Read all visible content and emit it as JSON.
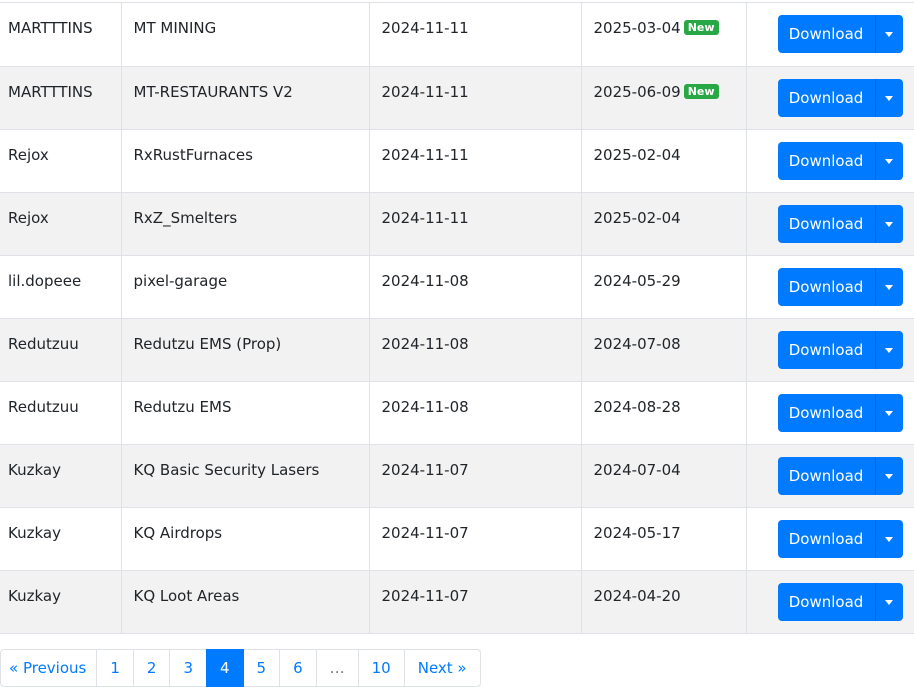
{
  "table": {
    "rows": [
      {
        "author": "MARTTTINS",
        "name": "MT MINING",
        "added": "2024-11-11",
        "updated": "2025-03-04",
        "badge": "New"
      },
      {
        "author": "MARTTTINS",
        "name": "MT-RESTAURANTS V2",
        "added": "2024-11-11",
        "updated": "2025-06-09",
        "badge": "New"
      },
      {
        "author": "Rejox",
        "name": "RxRustFurnaces",
        "added": "2024-11-11",
        "updated": "2025-02-04",
        "badge": ""
      },
      {
        "author": "Rejox",
        "name": "RxZ_Smelters",
        "added": "2024-11-11",
        "updated": "2025-02-04",
        "badge": ""
      },
      {
        "author": "lil.dopeee",
        "name": "pixel-garage",
        "added": "2024-11-08",
        "updated": "2024-05-29",
        "badge": ""
      },
      {
        "author": "Redutzuu",
        "name": "Redutzu EMS (Prop)",
        "added": "2024-11-08",
        "updated": "2024-07-08",
        "badge": ""
      },
      {
        "author": "Redutzuu",
        "name": "Redutzu EMS",
        "added": "2024-11-08",
        "updated": "2024-08-28",
        "badge": ""
      },
      {
        "author": "Kuzkay",
        "name": "KQ Basic Security Lasers",
        "added": "2024-11-07",
        "updated": "2024-07-04",
        "badge": ""
      },
      {
        "author": "Kuzkay",
        "name": "KQ Airdrops",
        "added": "2024-11-07",
        "updated": "2024-05-17",
        "badge": ""
      },
      {
        "author": "Kuzkay",
        "name": "KQ Loot Areas",
        "added": "2024-11-07",
        "updated": "2024-04-20",
        "badge": ""
      }
    ],
    "download_label": "Download"
  },
  "pagination": {
    "previous": "« Previous",
    "pages": [
      "1",
      "2",
      "3",
      "4",
      "5",
      "6",
      "…",
      "10"
    ],
    "active": "4",
    "next": "Next »"
  },
  "colors": {
    "primary": "#007bff",
    "badge": "#28a745",
    "row_stripe": "#f2f2f2"
  }
}
